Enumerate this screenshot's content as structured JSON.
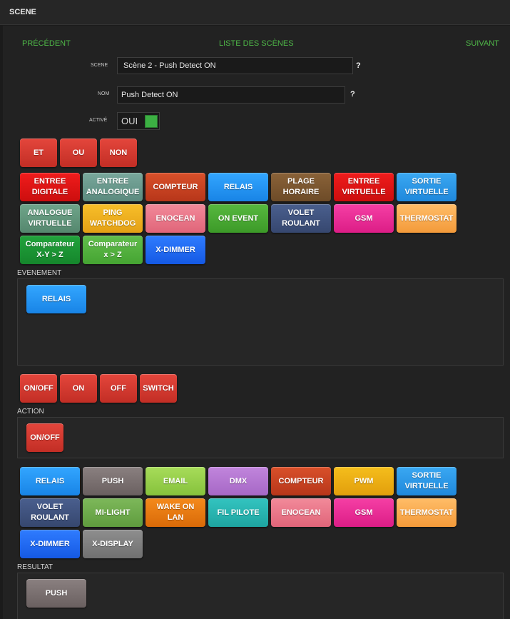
{
  "header": {
    "title": "SCENE"
  },
  "nav": {
    "previous": "PRÉCÉDENT",
    "list": "LISTE DES SCÈNES",
    "next": "SUIVANT"
  },
  "form": {
    "scene_label": "SCENE",
    "scene_value": "Scène 2 - Push Detect ON",
    "name_label": "NOM",
    "name_value": "Push Detect ON",
    "active_label": "ACTIVÉ",
    "active_value": "OUI",
    "help": "?"
  },
  "logic_buttons": [
    "ET",
    "OU",
    "NON"
  ],
  "event_types": [
    [
      "ENTREE",
      "DIGITALE"
    ],
    [
      "ENTREE",
      "ANALOGIQUE"
    ],
    [
      "COMPTEUR"
    ],
    [
      "RELAIS"
    ],
    [
      "PLAGE",
      "HORAIRE"
    ],
    [
      "ENTREE",
      "VIRTUELLE"
    ],
    [
      "SORTIE",
      "VIRTUELLE"
    ],
    [
      "ANALOGUE",
      "VIRTUELLE"
    ],
    [
      "PING",
      "WATCHDOG"
    ],
    [
      "ENOCEAN"
    ],
    [
      "ON EVENT"
    ],
    [
      "VOLET",
      "ROULANT"
    ],
    [
      "GSM"
    ],
    [
      "THERMOSTAT"
    ],
    [
      "Comparateur",
      "X-Y > Z"
    ],
    [
      "Comparateur",
      "x > Z"
    ],
    [
      "X-DIMMER"
    ]
  ],
  "event_section": {
    "title": "EVENEMENT",
    "items": [
      "RELAIS"
    ]
  },
  "action_buttons": [
    "ON/OFF",
    "ON",
    "OFF",
    "SWITCH"
  ],
  "action_section": {
    "title": "ACTION",
    "items": [
      "ON/OFF"
    ]
  },
  "result_types": [
    [
      "RELAIS"
    ],
    [
      "PUSH"
    ],
    [
      "EMAIL"
    ],
    [
      "DMX"
    ],
    [
      "COMPTEUR"
    ],
    [
      "PWM"
    ],
    [
      "SORTIE",
      "VIRTUELLE"
    ],
    [
      "VOLET",
      "ROULANT"
    ],
    [
      "MI-LIGHT"
    ],
    [
      "WAKE ON LAN"
    ],
    [
      "FIL PILOTE"
    ],
    [
      "ENOCEAN"
    ],
    [
      "GSM"
    ],
    [
      "THERMOSTAT"
    ],
    [
      "X-DIMMER"
    ],
    [
      "X-DISPLAY"
    ]
  ],
  "result_section": {
    "title": "RESULTAT",
    "items": [
      "PUSH"
    ]
  },
  "colors": {
    "accent_green": "#4fb848",
    "background": "#222222"
  }
}
